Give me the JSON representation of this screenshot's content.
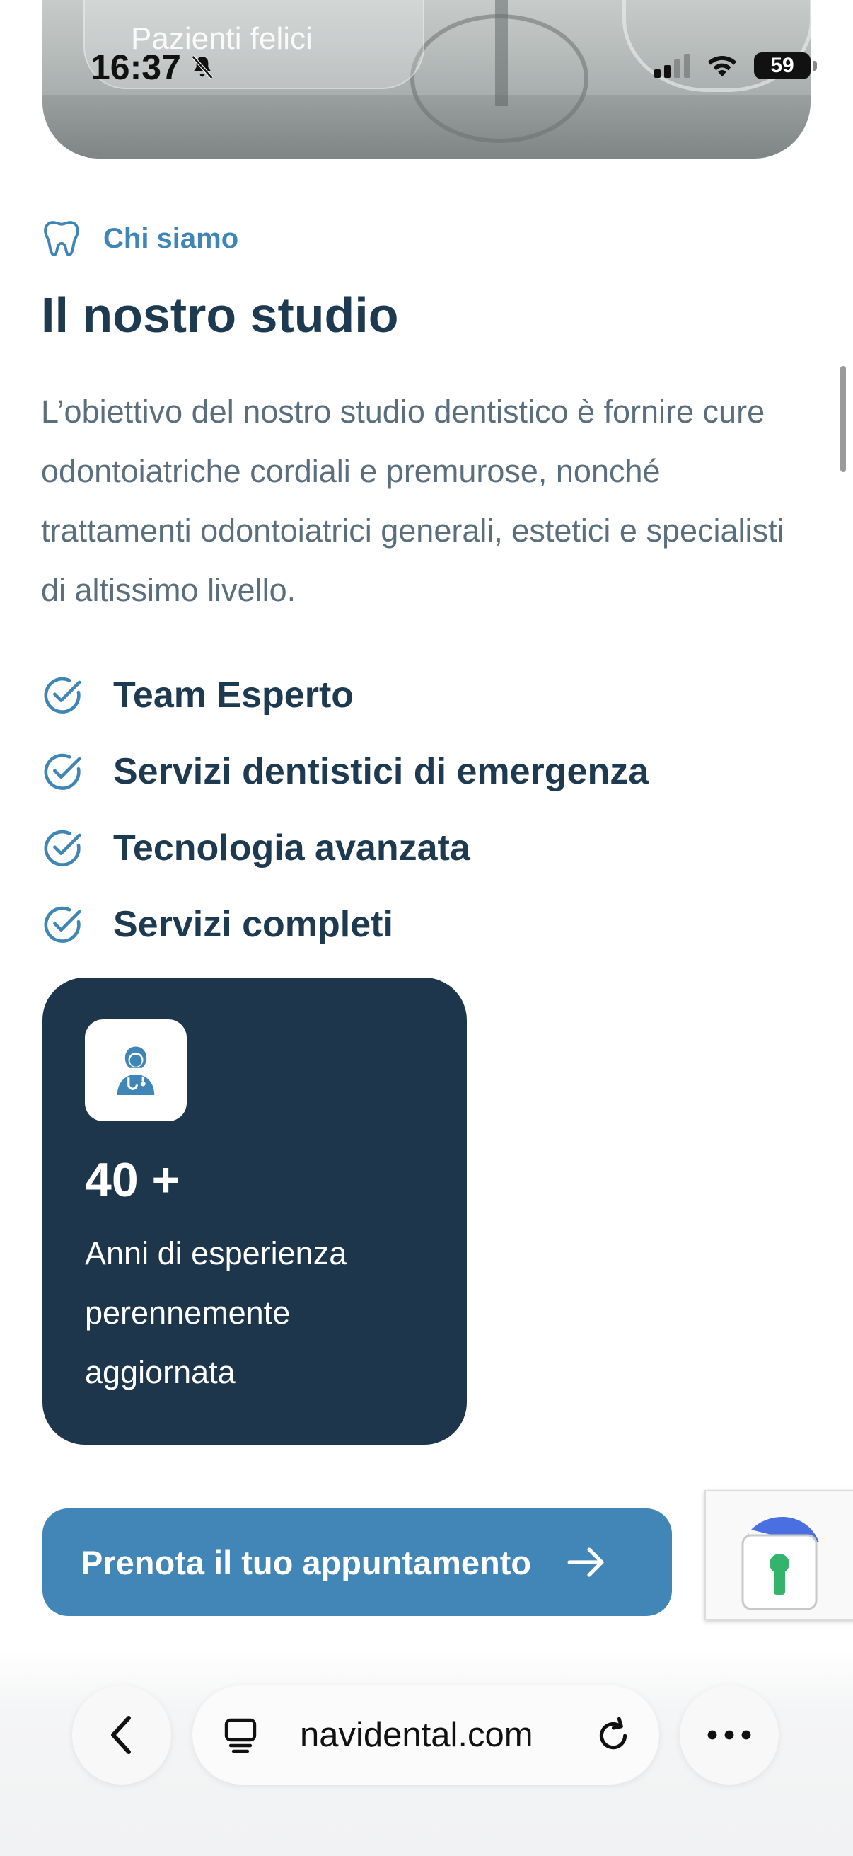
{
  "status_bar": {
    "time": "16:37",
    "battery": "59"
  },
  "hero": {
    "caption": "Pazienti felici"
  },
  "about": {
    "tag": "Chi siamo",
    "title": "Il nostro studio",
    "description": "L’obiettivo del nostro studio dentistico è fornire cure odontoiatriche cordiali e premurose, nonché trattamenti odontoiatrici generali, estetici e specialisti di altissimo livello.",
    "features": [
      "Team Esperto",
      "Servizi dentistici di emergenza",
      "Tecnologia avanzata",
      "Servizi completi"
    ]
  },
  "stat_card": {
    "value": "40 +",
    "description": "Anni di esperienza perennemente aggiornata"
  },
  "cta": {
    "label": "Prenota il tuo appuntamento"
  },
  "browser": {
    "url": "navidental.com"
  },
  "icons": {
    "section_tag": "tooth-icon",
    "feature_check": "check-circle-icon",
    "stat_icon": "doctor-icon",
    "cta_arrow": "arrow-right-icon",
    "recaptcha": "recaptcha-icon",
    "back": "chevron-left-icon",
    "tabs": "tabs-icon",
    "reload": "reload-icon",
    "more": "more-icon"
  },
  "colors": {
    "primary": "#4286b7",
    "dark": "#1e364b",
    "heading": "#1e3a50",
    "text": "#5b6e7d"
  }
}
